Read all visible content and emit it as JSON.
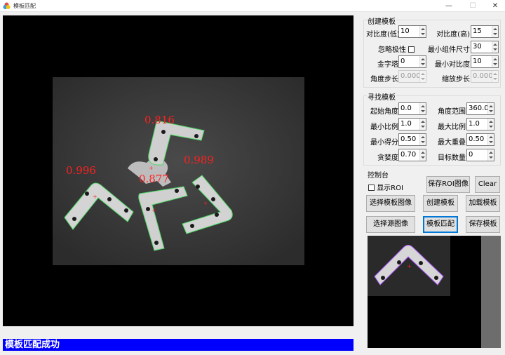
{
  "window": {
    "title": "模板匹配",
    "minimize": "—",
    "maximize": "☐",
    "close": "✕"
  },
  "viewer": {
    "scores": [
      "0.816",
      "0.996",
      "0.877",
      "0.989"
    ]
  },
  "status": {
    "message": "模板匹配成功"
  },
  "create_template": {
    "title": "创建模板",
    "contrast_low": {
      "label": "对比度(低)",
      "value": "10"
    },
    "contrast_high": {
      "label": "对比度(高)",
      "value": "15"
    },
    "ignore_polarity": {
      "label": "忽略极性",
      "checked": false
    },
    "min_component_size": {
      "label": "最小组件尺寸",
      "value": "30"
    },
    "pyramid": {
      "label": "金字塔",
      "value": "0"
    },
    "min_contrast": {
      "label": "最小对比度",
      "value": "10"
    },
    "angle_step": {
      "label": "角度步长",
      "value": "0.0000"
    },
    "scale_step": {
      "label": "缩放步长",
      "value": "0.0000"
    }
  },
  "find_template": {
    "title": "寻找模板",
    "start_angle": {
      "label": "起始角度",
      "value": "0.0"
    },
    "angle_range": {
      "label": "角度范围",
      "value": "360.0"
    },
    "min_scale": {
      "label": "最小比例",
      "value": "1.0"
    },
    "max_scale": {
      "label": "最大比例",
      "value": "1.0"
    },
    "min_score": {
      "label": "最小得分",
      "value": "0.50"
    },
    "max_overlap": {
      "label": "最大重叠",
      "value": "0.50"
    },
    "greediness": {
      "label": "贪婪度",
      "value": "0.70"
    },
    "target_count": {
      "label": "目标数量",
      "value": "0"
    }
  },
  "console": {
    "title": "控制台",
    "show_roi": {
      "label": "显示ROI",
      "checked": false
    },
    "save_roi_image": "保存ROI图像",
    "clear": "Clear",
    "select_template_image": "选择模板图像",
    "create_template": "创建模板",
    "load_template": "加载模板",
    "select_source_image": "选择源图像",
    "template_match": "模板匹配",
    "save_template": "保存模板"
  },
  "colors": {
    "status_bar": "#0000ff",
    "score_text": "#ff2020",
    "match_outline": "#4cd964",
    "active_button_border": "#0078d7"
  }
}
